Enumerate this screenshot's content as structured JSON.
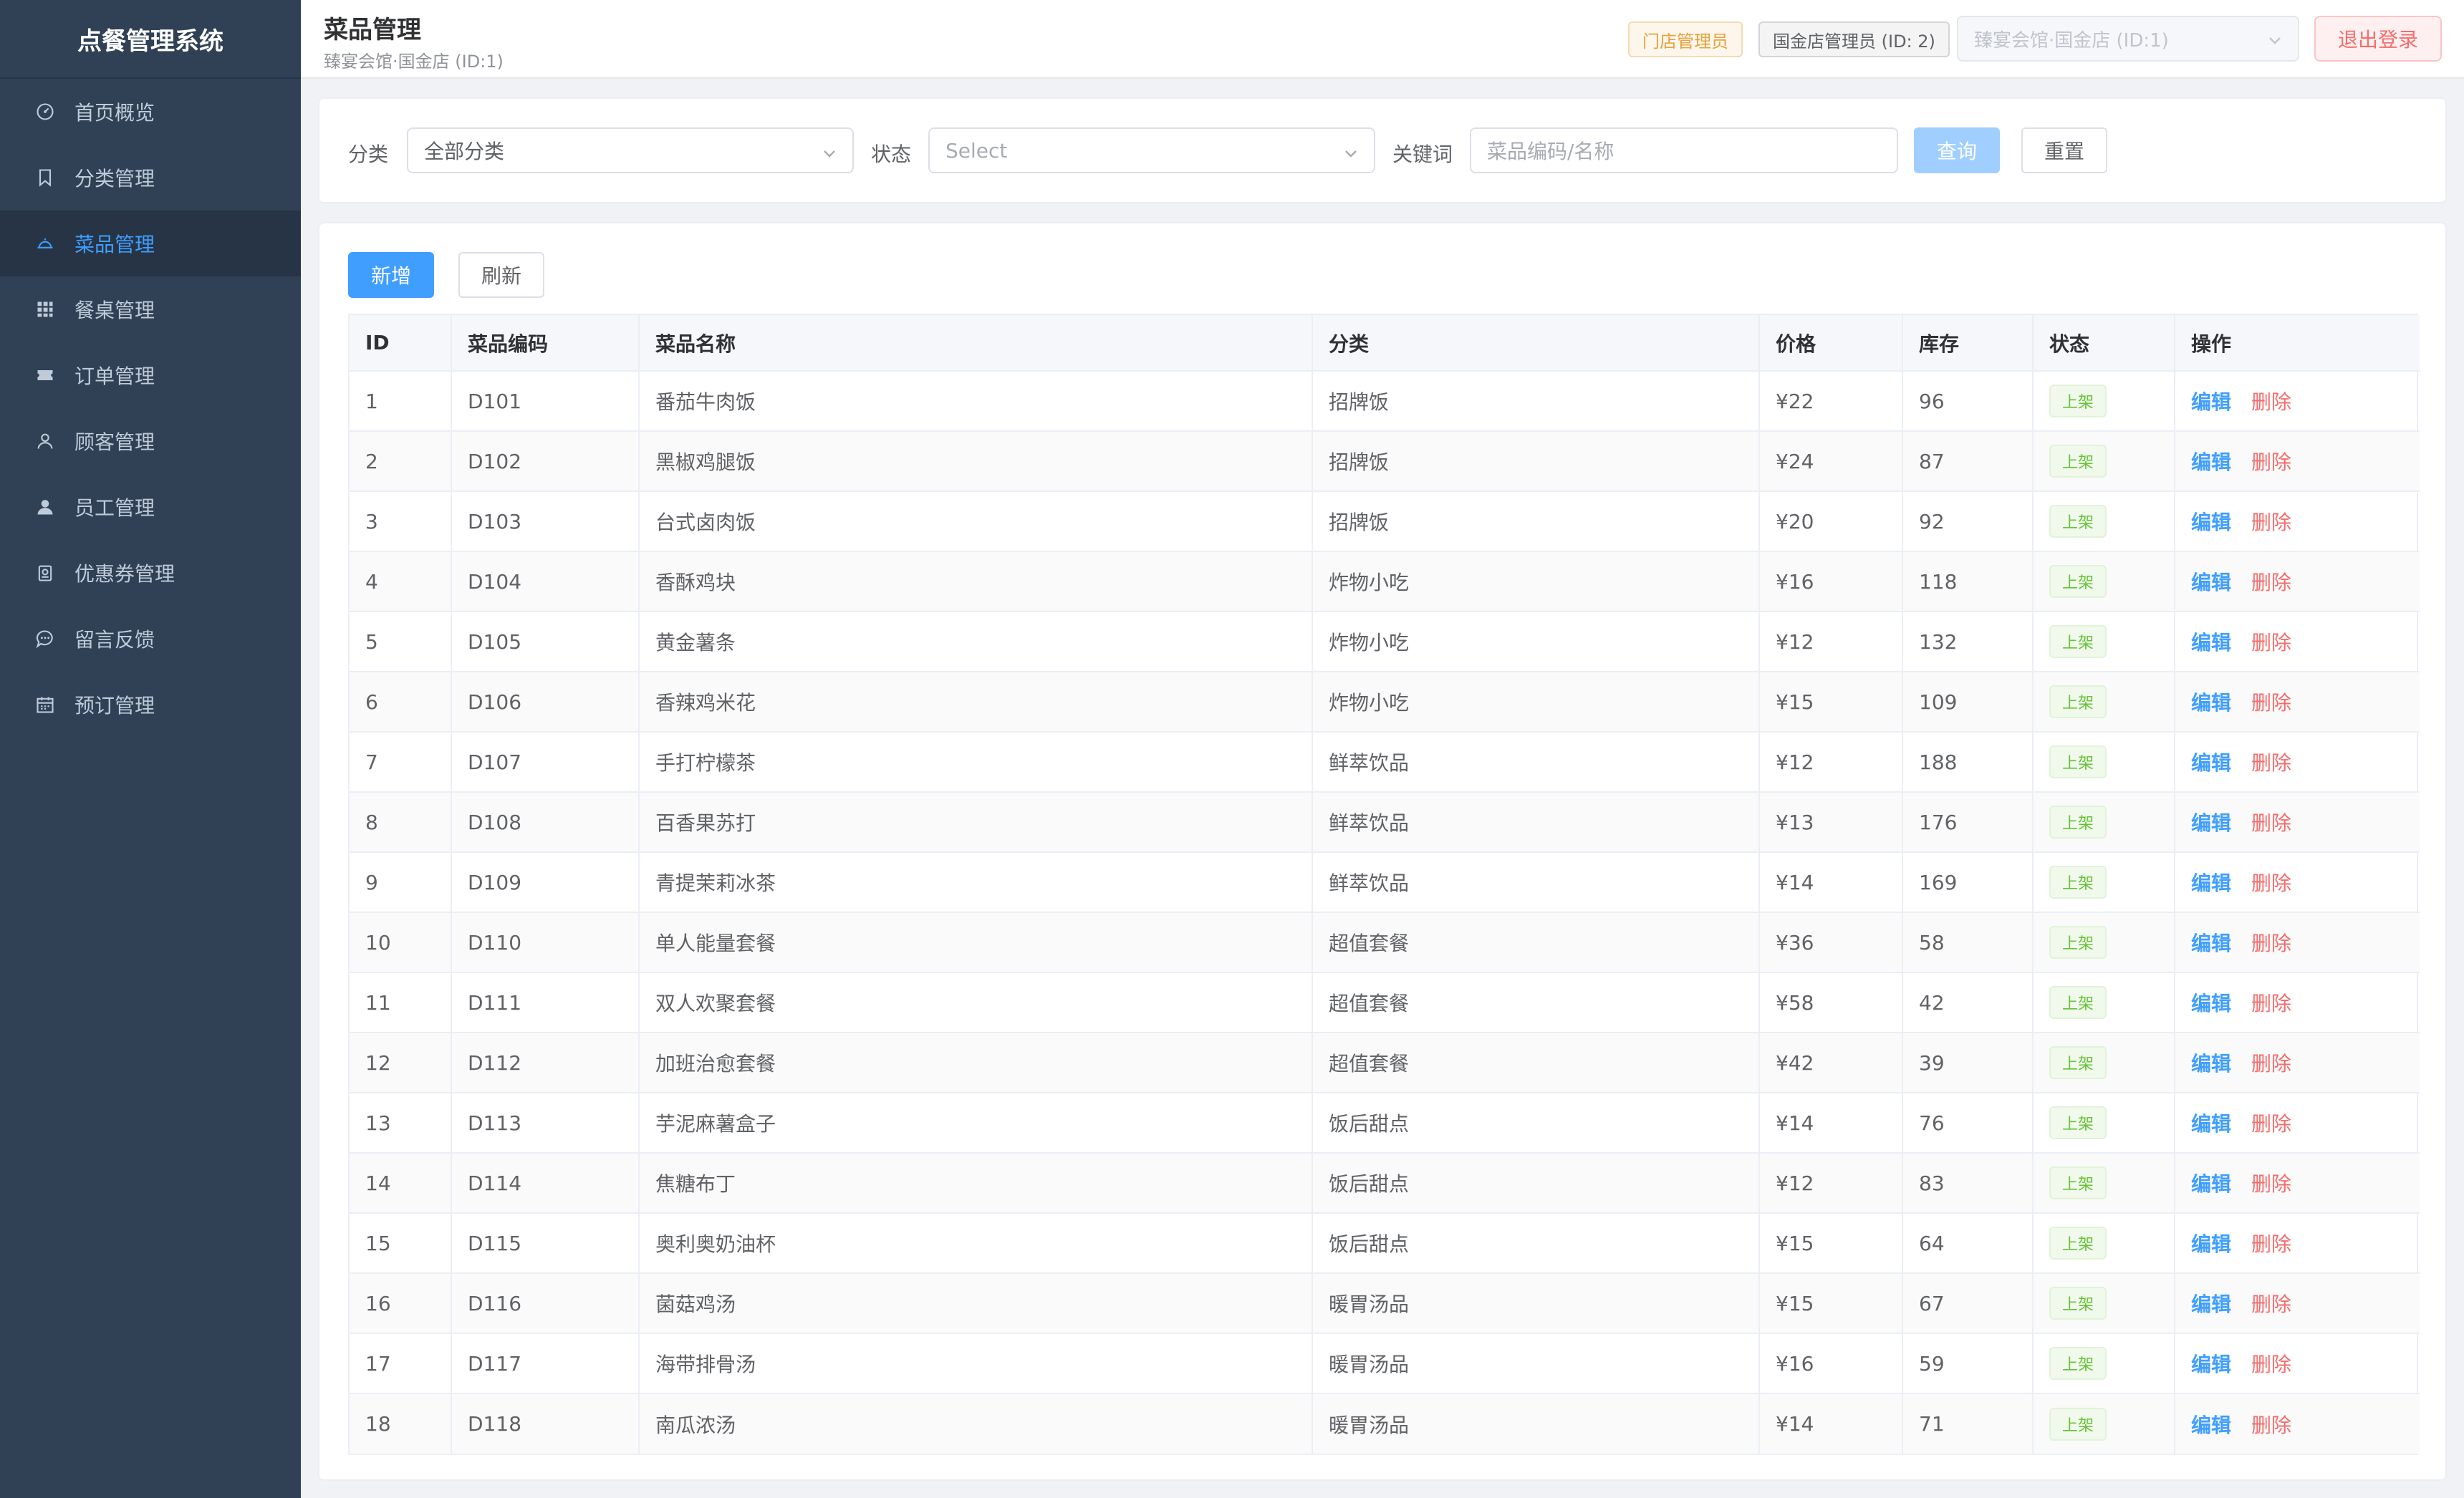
{
  "app": {
    "title": "点餐管理系统"
  },
  "sidebar": {
    "items": [
      {
        "label": "首页概览",
        "icon": "dashboard-icon",
        "active": false
      },
      {
        "label": "分类管理",
        "icon": "bookmark-icon",
        "active": false
      },
      {
        "label": "菜品管理",
        "icon": "dish-icon",
        "active": true
      },
      {
        "label": "餐桌管理",
        "icon": "grid-icon",
        "active": false
      },
      {
        "label": "订单管理",
        "icon": "ticket-icon",
        "active": false
      },
      {
        "label": "顾客管理",
        "icon": "user-outline-icon",
        "active": false
      },
      {
        "label": "员工管理",
        "icon": "user-filled-icon",
        "active": false
      },
      {
        "label": "优惠券管理",
        "icon": "coupon-icon",
        "active": false
      },
      {
        "label": "留言反馈",
        "icon": "chat-icon",
        "active": false
      },
      {
        "label": "预订管理",
        "icon": "calendar-icon",
        "active": false
      }
    ]
  },
  "header": {
    "title": "菜品管理",
    "subtitle": "臻宴会馆·国金店 (ID:1)",
    "role_tag": "门店管理员",
    "user_tag": "国金店管理员 (ID: 2)",
    "store_select": "臻宴会馆·国金店 (ID:1)",
    "logout_label": "退出登录"
  },
  "filters": {
    "category_label": "分类",
    "category_value": "全部分类",
    "status_label": "状态",
    "status_placeholder": "Select",
    "keyword_label": "关键词",
    "keyword_placeholder": "菜品编码/名称",
    "query_label": "查询",
    "reset_label": "重置"
  },
  "toolbar": {
    "add_label": "新增",
    "refresh_label": "刷新"
  },
  "table": {
    "columns": [
      "ID",
      "菜品编码",
      "菜品名称",
      "分类",
      "价格",
      "库存",
      "状态",
      "操作"
    ],
    "edit_label": "编辑",
    "delete_label": "删除",
    "rows": [
      {
        "id": "1",
        "code": "D101",
        "name": "番茄牛肉饭",
        "category": "招牌饭",
        "price": "¥22",
        "stock": "96",
        "status": "上架"
      },
      {
        "id": "2",
        "code": "D102",
        "name": "黑椒鸡腿饭",
        "category": "招牌饭",
        "price": "¥24",
        "stock": "87",
        "status": "上架"
      },
      {
        "id": "3",
        "code": "D103",
        "name": "台式卤肉饭",
        "category": "招牌饭",
        "price": "¥20",
        "stock": "92",
        "status": "上架"
      },
      {
        "id": "4",
        "code": "D104",
        "name": "香酥鸡块",
        "category": "炸物小吃",
        "price": "¥16",
        "stock": "118",
        "status": "上架"
      },
      {
        "id": "5",
        "code": "D105",
        "name": "黄金薯条",
        "category": "炸物小吃",
        "price": "¥12",
        "stock": "132",
        "status": "上架"
      },
      {
        "id": "6",
        "code": "D106",
        "name": "香辣鸡米花",
        "category": "炸物小吃",
        "price": "¥15",
        "stock": "109",
        "status": "上架"
      },
      {
        "id": "7",
        "code": "D107",
        "name": "手打柠檬茶",
        "category": "鲜萃饮品",
        "price": "¥12",
        "stock": "188",
        "status": "上架"
      },
      {
        "id": "8",
        "code": "D108",
        "name": "百香果苏打",
        "category": "鲜萃饮品",
        "price": "¥13",
        "stock": "176",
        "status": "上架"
      },
      {
        "id": "9",
        "code": "D109",
        "name": "青提茉莉冰茶",
        "category": "鲜萃饮品",
        "price": "¥14",
        "stock": "169",
        "status": "上架"
      },
      {
        "id": "10",
        "code": "D110",
        "name": "单人能量套餐",
        "category": "超值套餐",
        "price": "¥36",
        "stock": "58",
        "status": "上架"
      },
      {
        "id": "11",
        "code": "D111",
        "name": "双人欢聚套餐",
        "category": "超值套餐",
        "price": "¥58",
        "stock": "42",
        "status": "上架"
      },
      {
        "id": "12",
        "code": "D112",
        "name": "加班治愈套餐",
        "category": "超值套餐",
        "price": "¥42",
        "stock": "39",
        "status": "上架"
      },
      {
        "id": "13",
        "code": "D113",
        "name": "芋泥麻薯盒子",
        "category": "饭后甜点",
        "price": "¥14",
        "stock": "76",
        "status": "上架"
      },
      {
        "id": "14",
        "code": "D114",
        "name": "焦糖布丁",
        "category": "饭后甜点",
        "price": "¥12",
        "stock": "83",
        "status": "上架"
      },
      {
        "id": "15",
        "code": "D115",
        "name": "奥利奥奶油杯",
        "category": "饭后甜点",
        "price": "¥15",
        "stock": "64",
        "status": "上架"
      },
      {
        "id": "16",
        "code": "D116",
        "name": "菌菇鸡汤",
        "category": "暖胃汤品",
        "price": "¥15",
        "stock": "67",
        "status": "上架"
      },
      {
        "id": "17",
        "code": "D117",
        "name": "海带排骨汤",
        "category": "暖胃汤品",
        "price": "¥16",
        "stock": "59",
        "status": "上架"
      },
      {
        "id": "18",
        "code": "D118",
        "name": "南瓜浓汤",
        "category": "暖胃汤品",
        "price": "¥14",
        "stock": "71",
        "status": "上架"
      }
    ]
  },
  "colors": {
    "sidebar_bg": "#304156",
    "sidebar_active_bg": "#263445",
    "primary": "#409eff",
    "danger": "#f56c6c",
    "success": "#67c23a",
    "warning": "#e6a23c"
  }
}
